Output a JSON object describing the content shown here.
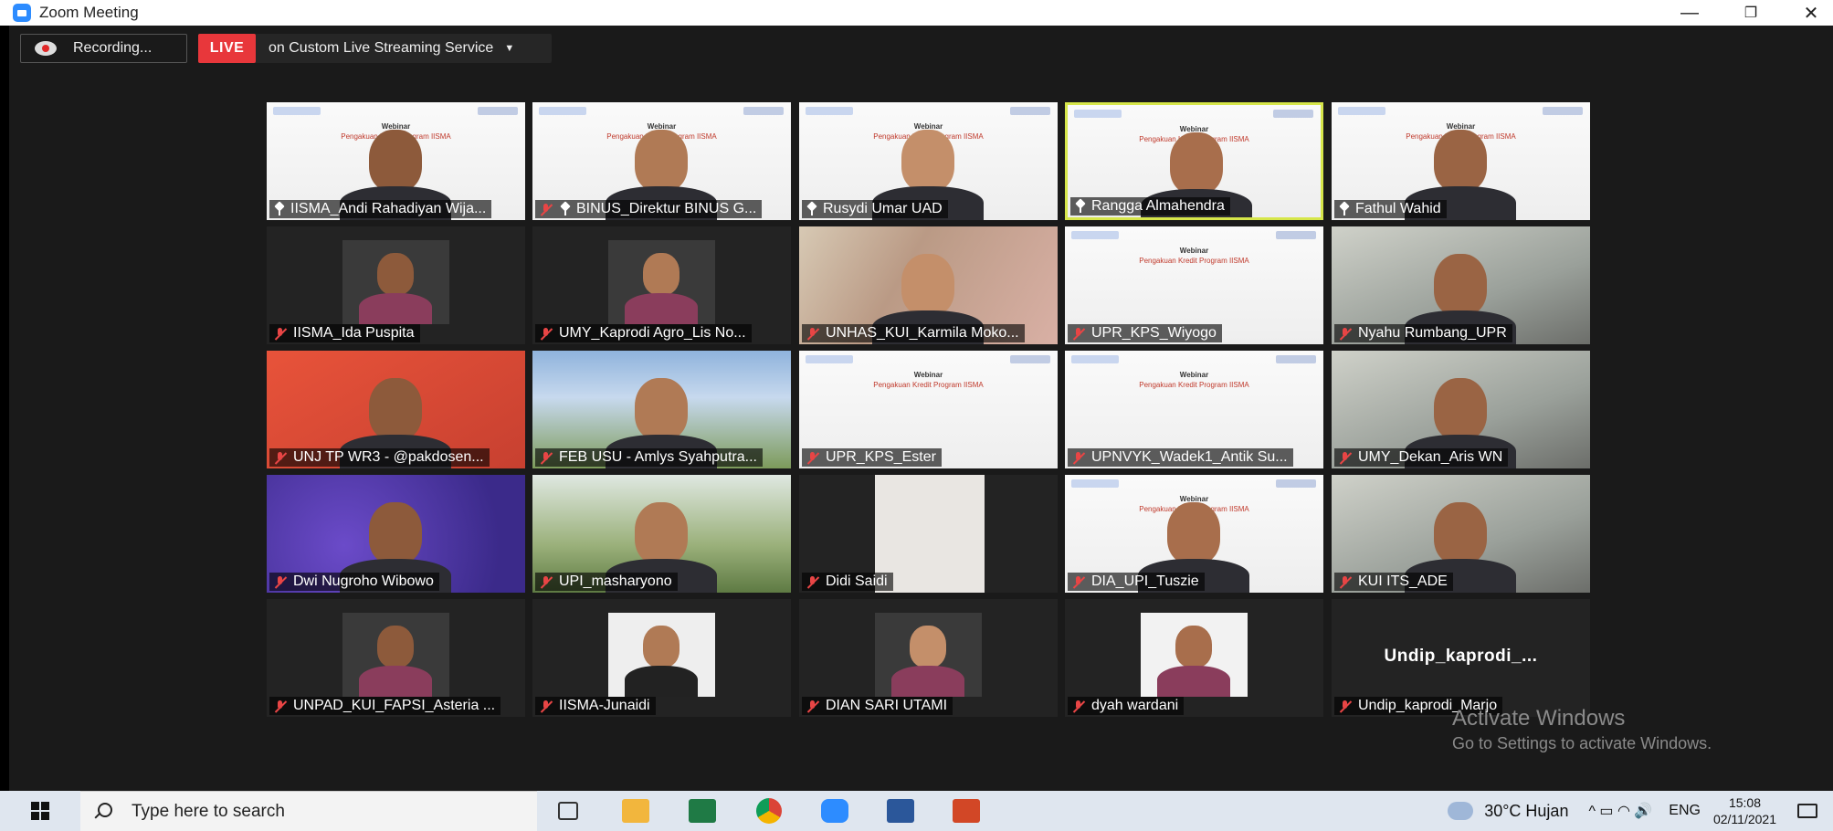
{
  "window": {
    "title": "Zoom Meeting",
    "minimize": "—",
    "restore": "❐",
    "close": "✕"
  },
  "recording": {
    "label": "Recording..."
  },
  "live": {
    "badge": "LIVE",
    "text": "on Custom Live Streaming Service",
    "caret": "▼"
  },
  "slide": {
    "title": "Webinar",
    "subtitle": "Pengakuan Kredit Program IISMA"
  },
  "participants": [
    {
      "name": "IISMA_Andi Rahadiyan Wija...",
      "bg": "slide",
      "pinned": true,
      "muted": false
    },
    {
      "name": "BINUS_Direktur BINUS G...",
      "bg": "slide",
      "pinned": true,
      "muted": true
    },
    {
      "name": "Rusydi Umar UAD",
      "bg": "slide",
      "pinned": true,
      "muted": false
    },
    {
      "name": "Rangga Almahendra",
      "bg": "slide",
      "pinned": true,
      "muted": false,
      "active": true
    },
    {
      "name": "Fathul Wahid",
      "bg": "slide",
      "pinned": true,
      "muted": false
    },
    {
      "name": "IISMA_Ida Puspita",
      "bg": "dark",
      "muted": true
    },
    {
      "name": "UMY_Kaprodi Agro_Lis No...",
      "bg": "dark",
      "muted": true
    },
    {
      "name": "UNHAS_KUI_Karmila Moko...",
      "bg": "blurred",
      "muted": true
    },
    {
      "name": "UPR_KPS_Wiyogo",
      "bg": "slide",
      "muted": true
    },
    {
      "name": "Nyahu Rumbang_UPR",
      "bg": "room",
      "muted": true
    },
    {
      "name": "UNJ TP WR3 - @pakdosen...",
      "bg": "red",
      "muted": true
    },
    {
      "name": "FEB USU - Amlys Syahputra...",
      "bg": "campus",
      "muted": true
    },
    {
      "name": "UPR_KPS_Ester",
      "bg": "slide",
      "muted": true
    },
    {
      "name": "UPNVYK_Wadek1_Antik Su...",
      "bg": "slide",
      "muted": true
    },
    {
      "name": "UMY_Dekan_Aris WN",
      "bg": "room",
      "muted": true
    },
    {
      "name": "Dwi Nugroho Wibowo",
      "bg": "purple",
      "muted": true
    },
    {
      "name": "UPI_masharyono",
      "bg": "green",
      "muted": true
    },
    {
      "name": "Didi Saidi",
      "bg": "dark",
      "muted": true
    },
    {
      "name": "DIA_UPI_Tuszie",
      "bg": "slide",
      "muted": true
    },
    {
      "name": "KUI ITS_ADE",
      "bg": "room",
      "muted": true
    },
    {
      "name": "UNPAD_KUI_FAPSI_Asteria ...",
      "bg": "dark",
      "muted": true
    },
    {
      "name": "IISMA-Junaidi",
      "bg": "dark",
      "muted": true
    },
    {
      "name": "DIAN SARI UTAMI",
      "bg": "dark",
      "muted": true
    },
    {
      "name": "dyah wardani",
      "bg": "dark",
      "muted": true
    },
    {
      "name": "Undip_kaprodi_Marjo",
      "bg": "dark",
      "muted": true,
      "display_name": "Undip_kaprodi_..."
    }
  ],
  "activate": {
    "line1": "Activate Windows",
    "line2": "Go to Settings to activate Windows."
  },
  "taskbar": {
    "search_placeholder": "Type here to search",
    "weather": "30°C  Hujan",
    "lang": "ENG",
    "time": "15:08",
    "date": "02/11/2021",
    "tray_icons": "^ ▭ ◠ 🔊"
  },
  "colors": {
    "active_border": "#d6e64a",
    "live_red": "#e8373b",
    "muted_red": "#e84545"
  }
}
